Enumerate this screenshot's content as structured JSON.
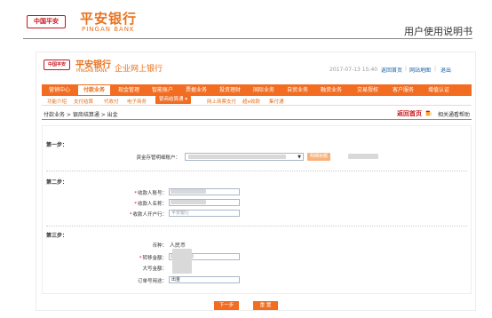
{
  "doc": {
    "logo_badge": "中国平安",
    "logo_cn": "平安银行",
    "logo_en": "PINGAN BANK",
    "title": "用户使用说明书"
  },
  "app": {
    "badge": "中国平安",
    "brand_cn": "平安银行",
    "brand_en": "PINGAN BANK",
    "name": "企业网上银行",
    "date": "2017-07-13",
    "time": "15:40",
    "links": [
      "返回首页",
      "网站地图",
      "退出"
    ]
  },
  "main_nav": [
    "营销中心",
    "付款业务",
    "现金管理",
    "智能账户",
    "票据业务",
    "投资理财",
    "国际业务",
    "自贸业务",
    "融资业务",
    "交易授权",
    "客户服务",
    "增值认证"
  ],
  "active_nav": "付款业务",
  "sub_nav": [
    "功能介绍",
    "支付结算",
    "代收付",
    "电子商务",
    "银商结算通",
    "网上商票支付",
    "超e收款",
    "集付通"
  ],
  "active_sub": "银商结算通",
  "breadcrumb": "付款业务 > 银商结算通 > 出金",
  "return_link": "返回首页",
  "help_link": "相关通看帮助",
  "form": {
    "step1": "第一步：",
    "account_label": "资金存管明细账户：",
    "query_btn": "明细余额",
    "step2": "第二步：",
    "payee_account_label": "收款人账号：",
    "payee_name_label": "收款人名称：",
    "payee_bank_label": "收款人开户行：",
    "payee_bank_value": "平安银行",
    "step3": "第三步：",
    "currency_label": "币种：",
    "currency_value": "人民币",
    "amount_label": "转移金额：",
    "amount_upper_label": "大写金额：",
    "purpose_label": "订单号用途：",
    "purpose_value": "出金"
  },
  "buttons": {
    "next": "下一步",
    "reset": "重 置"
  }
}
